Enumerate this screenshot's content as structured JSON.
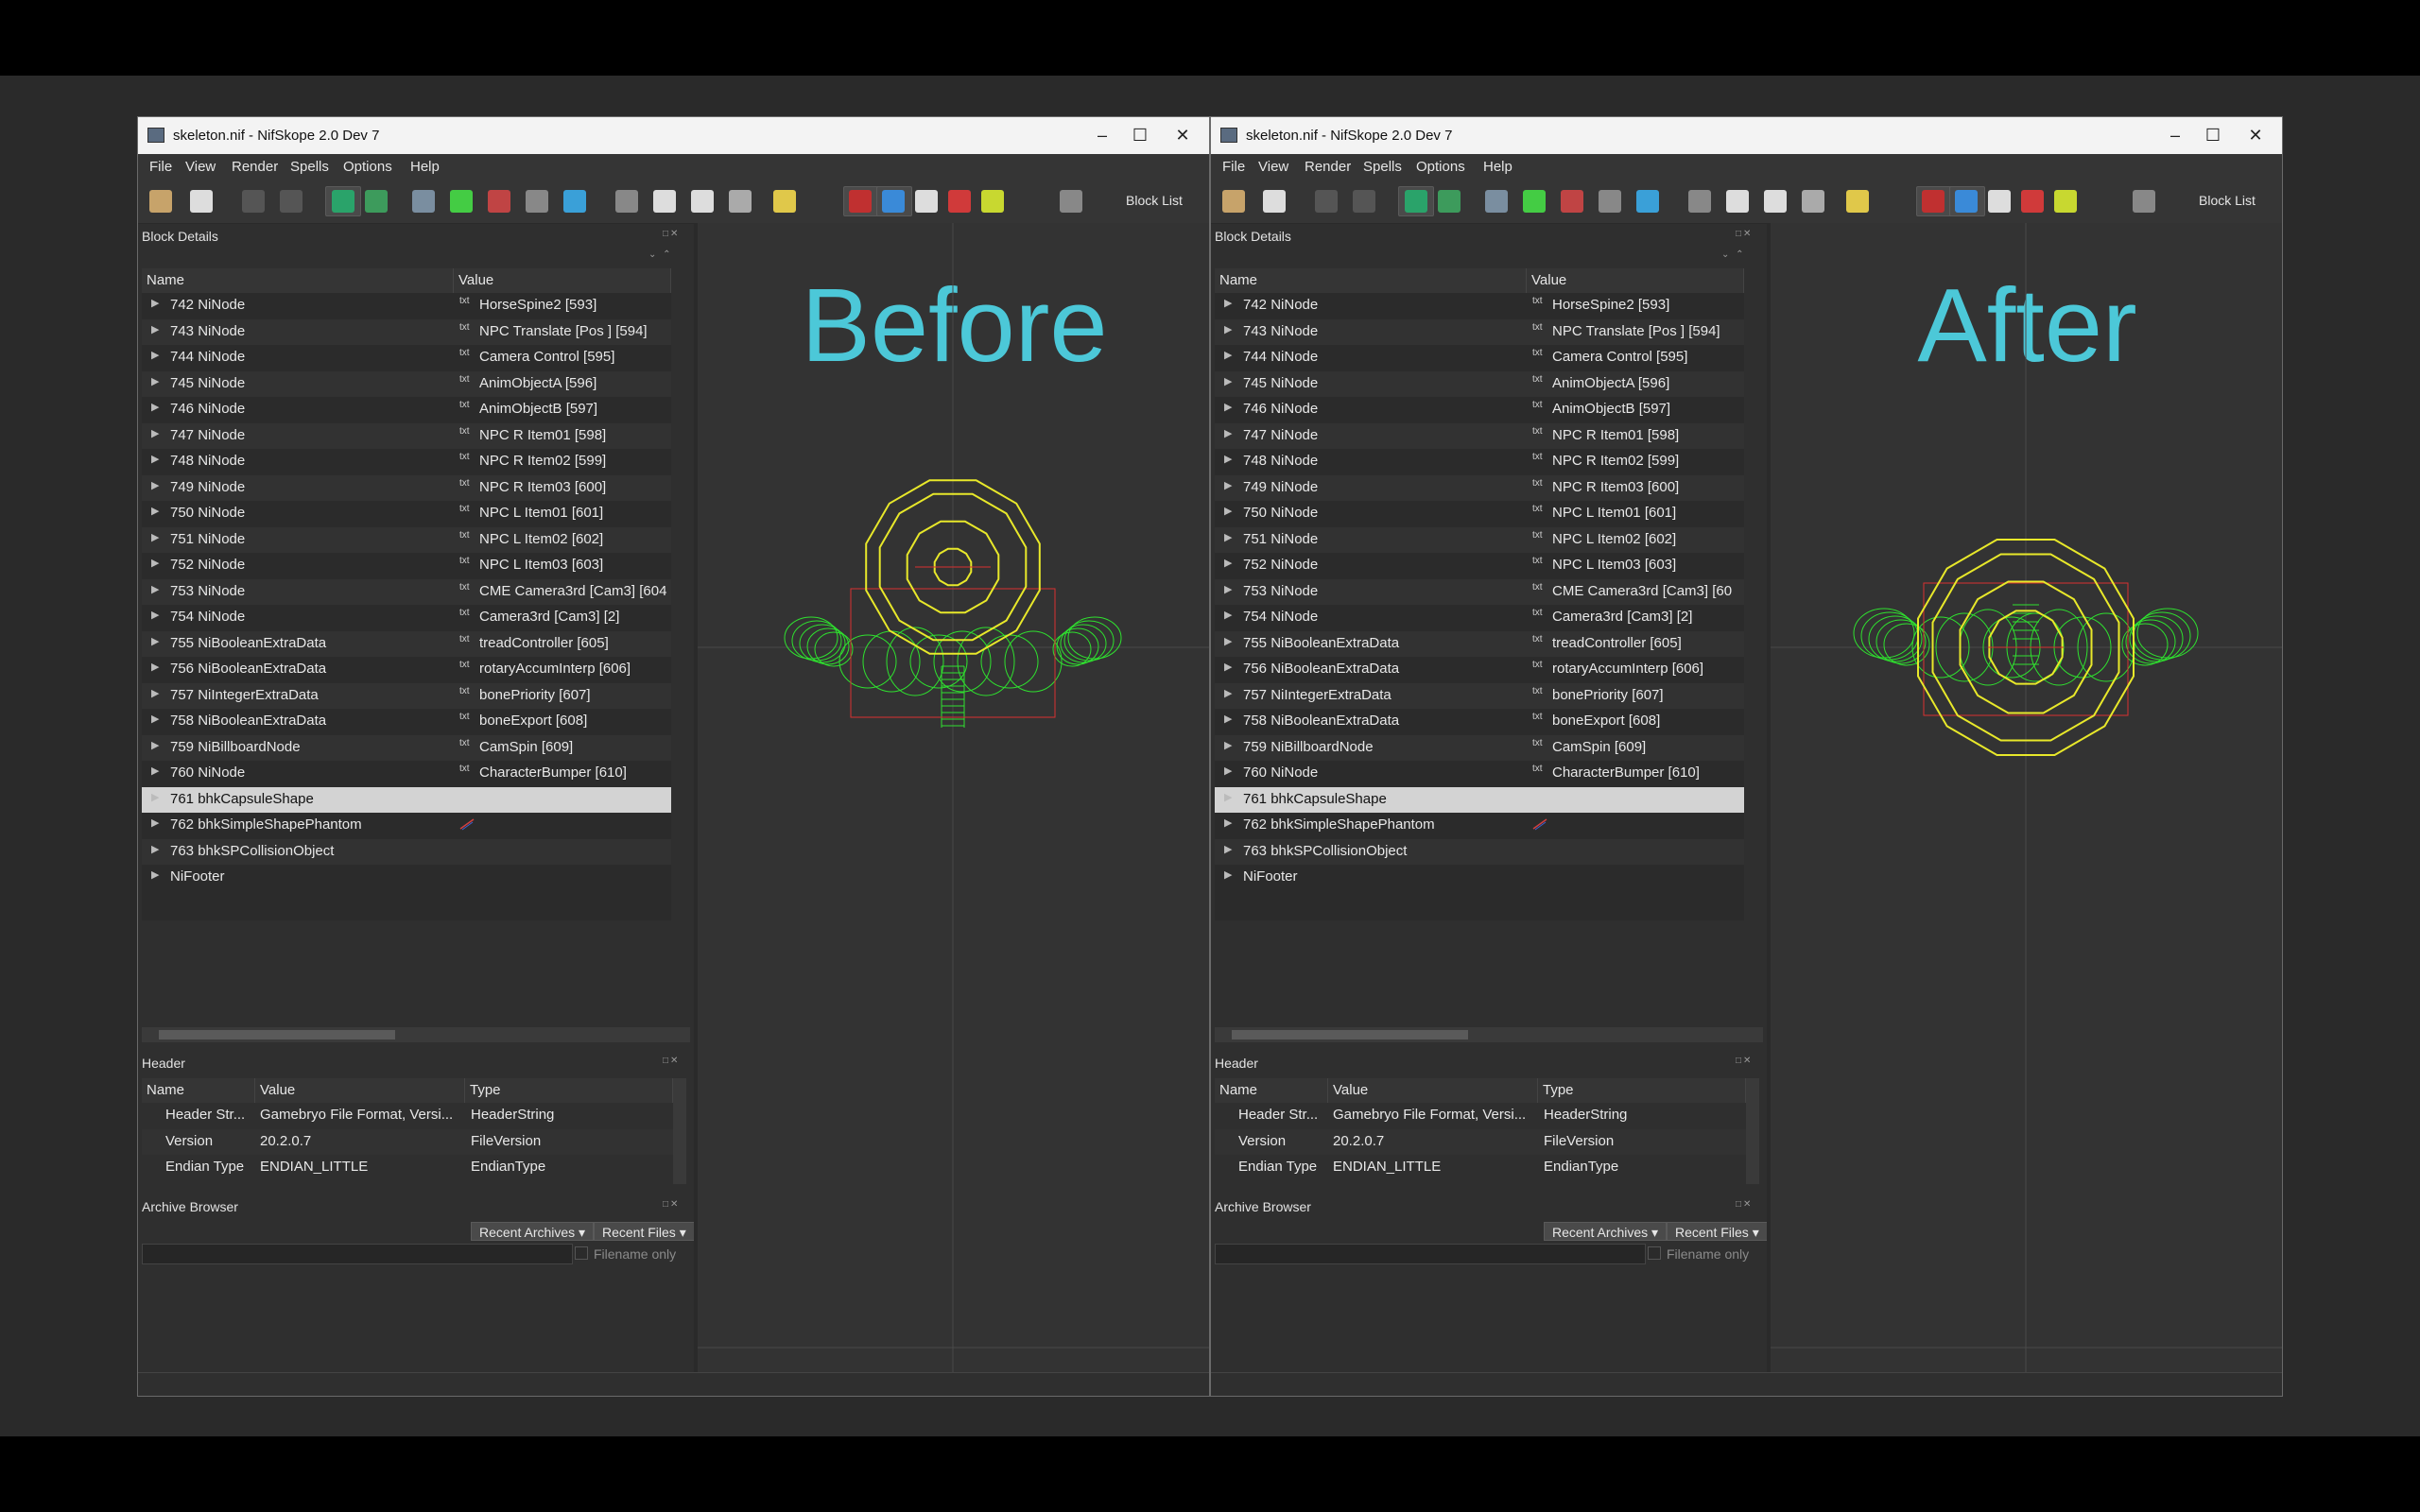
{
  "windows": [
    {
      "id": "left",
      "title": "skeleton.nif - NifSkope 2.0 Dev 7",
      "overlay_label": "Before",
      "menu": [
        "File",
        "View",
        "Render",
        "Spells",
        "Options",
        "Help"
      ],
      "toolbar_blocklist_label": "Block List",
      "block_details": {
        "title": "Block Details",
        "columns": [
          "Name",
          "Value"
        ],
        "rows": [
          {
            "name": "742 NiNode",
            "value": "HorseSpine2 [593]"
          },
          {
            "name": "743 NiNode",
            "value": "NPC Translate [Pos ] [594]"
          },
          {
            "name": "744 NiNode",
            "value": "Camera Control [595]"
          },
          {
            "name": "745 NiNode",
            "value": "AnimObjectA [596]"
          },
          {
            "name": "746 NiNode",
            "value": "AnimObjectB [597]"
          },
          {
            "name": "747 NiNode",
            "value": "NPC R Item01 [598]"
          },
          {
            "name": "748 NiNode",
            "value": "NPC R Item02 [599]"
          },
          {
            "name": "749 NiNode",
            "value": "NPC R Item03 [600]"
          },
          {
            "name": "750 NiNode",
            "value": "NPC L Item01 [601]"
          },
          {
            "name": "751 NiNode",
            "value": "NPC L Item02 [602]"
          },
          {
            "name": "752 NiNode",
            "value": "NPC L Item03 [603]"
          },
          {
            "name": "753 NiNode",
            "value": "CME Camera3rd [Cam3] [604"
          },
          {
            "name": "754 NiNode",
            "value": "Camera3rd [Cam3] [2]"
          },
          {
            "name": "755 NiBooleanExtraData",
            "value": "treadController [605]"
          },
          {
            "name": "756 NiBooleanExtraData",
            "value": "rotaryAccumInterp [606]"
          },
          {
            "name": "757 NiIntegerExtraData",
            "value": "bonePriority [607]"
          },
          {
            "name": "758 NiBooleanExtraData",
            "value": "boneExport [608]"
          },
          {
            "name": "759 NiBillboardNode",
            "value": "CamSpin [609]"
          },
          {
            "name": "760 NiNode",
            "value": "CharacterBumper [610]"
          },
          {
            "name": "761 bhkCapsuleShape",
            "value": "",
            "selected": true
          },
          {
            "name": "762 bhkSimpleShapePhantom",
            "value": "",
            "havok_icon": true
          },
          {
            "name": "763 bhkSPCollisionObject",
            "value": ""
          },
          {
            "name": "NiFooter",
            "value": ""
          }
        ]
      },
      "header": {
        "title": "Header",
        "columns": [
          "Name",
          "Value",
          "Type"
        ],
        "rows": [
          {
            "name": "Header Str...",
            "value": "Gamebryo File Format, Versi...",
            "type": "HeaderString"
          },
          {
            "name": "Version",
            "value": "20.2.0.7",
            "type": "FileVersion"
          },
          {
            "name": "Endian Type",
            "value": "ENDIAN_LITTLE",
            "type": "EndianType"
          }
        ]
      },
      "archive_browser": {
        "title": "Archive Browser",
        "recent_archives": "Recent Archives",
        "recent_files": "Recent Files",
        "filename_only": "Filename only"
      }
    },
    {
      "id": "right",
      "title": "skeleton.nif - NifSkope 2.0 Dev 7",
      "overlay_label": "After",
      "menu": [
        "File",
        "View",
        "Render",
        "Spells",
        "Options",
        "Help"
      ],
      "toolbar_blocklist_label": "Block List",
      "block_details": {
        "title": "Block Details",
        "columns": [
          "Name",
          "Value"
        ],
        "rows": [
          {
            "name": "742 NiNode",
            "value": "HorseSpine2 [593]"
          },
          {
            "name": "743 NiNode",
            "value": "NPC Translate [Pos ] [594]"
          },
          {
            "name": "744 NiNode",
            "value": "Camera Control [595]"
          },
          {
            "name": "745 NiNode",
            "value": "AnimObjectA [596]"
          },
          {
            "name": "746 NiNode",
            "value": "AnimObjectB [597]"
          },
          {
            "name": "747 NiNode",
            "value": "NPC R Item01 [598]"
          },
          {
            "name": "748 NiNode",
            "value": "NPC R Item02 [599]"
          },
          {
            "name": "749 NiNode",
            "value": "NPC R Item03 [600]"
          },
          {
            "name": "750 NiNode",
            "value": "NPC L Item01 [601]"
          },
          {
            "name": "751 NiNode",
            "value": "NPC L Item02 [602]"
          },
          {
            "name": "752 NiNode",
            "value": "NPC L Item03 [603]"
          },
          {
            "name": "753 NiNode",
            "value": "CME Camera3rd [Cam3] [60"
          },
          {
            "name": "754 NiNode",
            "value": "Camera3rd [Cam3] [2]"
          },
          {
            "name": "755 NiBooleanExtraData",
            "value": "treadController [605]"
          },
          {
            "name": "756 NiBooleanExtraData",
            "value": "rotaryAccumInterp [606]"
          },
          {
            "name": "757 NiIntegerExtraData",
            "value": "bonePriority [607]"
          },
          {
            "name": "758 NiBooleanExtraData",
            "value": "boneExport [608]"
          },
          {
            "name": "759 NiBillboardNode",
            "value": "CamSpin [609]"
          },
          {
            "name": "760 NiNode",
            "value": "CharacterBumper [610]"
          },
          {
            "name": "761 bhkCapsuleShape",
            "value": "",
            "selected": true
          },
          {
            "name": "762 bhkSimpleShapePhantom",
            "value": "",
            "havok_icon": true
          },
          {
            "name": "763 bhkSPCollisionObject",
            "value": ""
          },
          {
            "name": "NiFooter",
            "value": ""
          }
        ]
      },
      "header": {
        "title": "Header",
        "columns": [
          "Name",
          "Value",
          "Type"
        ],
        "rows": [
          {
            "name": "Header Str...",
            "value": "Gamebryo File Format, Versi...",
            "type": "HeaderString"
          },
          {
            "name": "Version",
            "value": "20.2.0.7",
            "type": "FileVersion"
          },
          {
            "name": "Endian Type",
            "value": "ENDIAN_LITTLE",
            "type": "EndianType"
          }
        ]
      },
      "archive_browser": {
        "title": "Archive Browser",
        "recent_archives": "Recent Archives",
        "recent_files": "Recent Files",
        "filename_only": "Filename only"
      }
    }
  ],
  "colors": {
    "overlay_label": "#4cc8d8",
    "wireframe_green": "#2fe02f",
    "wireframe_yellow": "#e8e82a",
    "bbox_red": "#d83030"
  }
}
